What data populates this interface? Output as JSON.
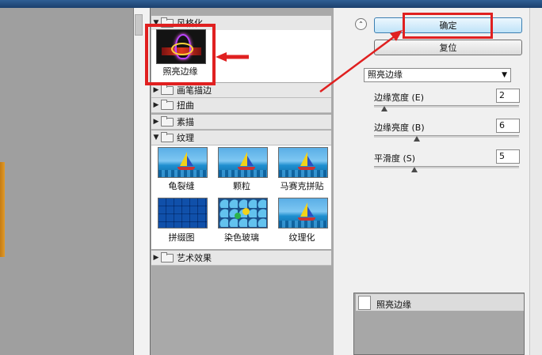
{
  "gallery": {
    "categories": [
      {
        "label": "风格化",
        "expanded": true
      },
      {
        "label": "画笔描边",
        "expanded": false
      },
      {
        "label": "扭曲",
        "expanded": false
      },
      {
        "label": "素描",
        "expanded": false
      },
      {
        "label": "纹理",
        "expanded": true
      },
      {
        "label": "艺术效果",
        "expanded": false
      }
    ],
    "stylize_filters": [
      "照亮边缘"
    ],
    "texture_filters": [
      "龟裂缝",
      "颗粒",
      "马赛克拼贴",
      "拼缀图",
      "染色玻璃",
      "纹理化"
    ]
  },
  "buttons": {
    "ok": "确定",
    "reset": "复位"
  },
  "filter_select": {
    "value": "照亮边缘"
  },
  "params": [
    {
      "label": "边缘宽度 (E)",
      "value": "2",
      "level": 0.08
    },
    {
      "label": "边缘亮度 (B)",
      "value": "6",
      "level": 0.3
    },
    {
      "label": "平滑度 (S)",
      "value": "5",
      "level": 0.3
    }
  ],
  "layers": {
    "items": [
      "照亮边缘"
    ]
  },
  "colors": {
    "highlight": "#e02020",
    "accent": "#3c7fb1"
  }
}
